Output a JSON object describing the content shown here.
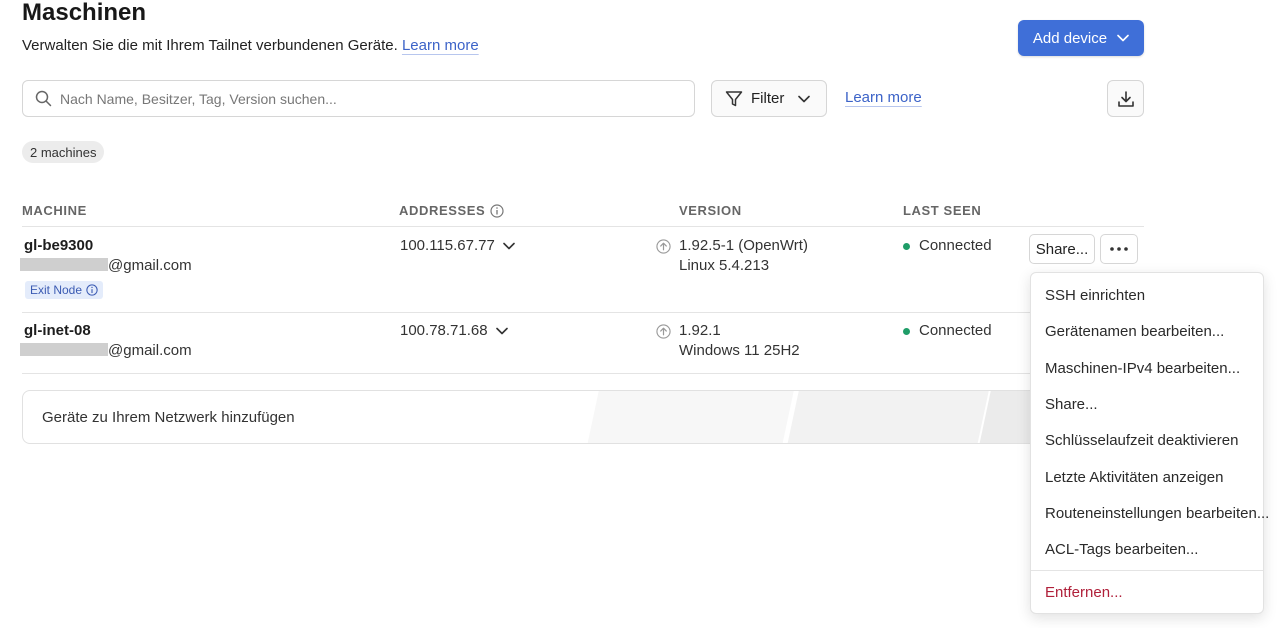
{
  "header": {
    "title": "Maschinen",
    "subtitle": "Verwalten Sie die mit Ihrem Tailnet verbundenen Geräte.",
    "learn_more": "Learn more",
    "add_device": "Add device"
  },
  "toolbar": {
    "search_placeholder": "Nach Name, Besitzer, Tag, Version suchen...",
    "filter_label": "Filter",
    "learn_more": "Learn more"
  },
  "count_badge": "2 machines",
  "table": {
    "columns": [
      "MACHINE",
      "ADDRESSES",
      "VERSION",
      "LAST SEEN"
    ],
    "rows": [
      {
        "name": "gl-be9300",
        "email_suffix": "@gmail.com",
        "badge": "Exit Node",
        "address": "100.115.67.77",
        "version": "1.92.5-1 (OpenWrt)",
        "os": "Linux 5.4.213",
        "last_seen": "Connected"
      },
      {
        "name": "gl-inet-08",
        "email_suffix": "@gmail.com",
        "address": "100.78.71.68",
        "version": "1.92.1",
        "os": "Windows 11 25H2",
        "last_seen": "Connected"
      }
    ],
    "share_label": "Share..."
  },
  "add_card": {
    "label": "Geräte zu Ihrem Netzwerk hinzufügen"
  },
  "menu": {
    "items": [
      "SSH einrichten",
      "Gerätenamen bearbeiten...",
      "Maschinen-IPv4 bearbeiten...",
      "Share...",
      "Schlüsselaufzeit deaktivieren",
      "Letzte Aktivitäten anzeigen",
      "Routeneinstellungen bearbeiten...",
      "ACL-Tags bearbeiten..."
    ],
    "danger_item": "Entfernen..."
  },
  "colors": {
    "accent": "#3f6fd8",
    "link": "#3c63c8",
    "connected": "#1f9d68",
    "danger": "#b0203a"
  },
  "icons": [
    "search-icon",
    "filter-icon",
    "chevron-down-icon",
    "download-icon",
    "info-icon",
    "update-arrow-icon",
    "more-dots-icon"
  ]
}
